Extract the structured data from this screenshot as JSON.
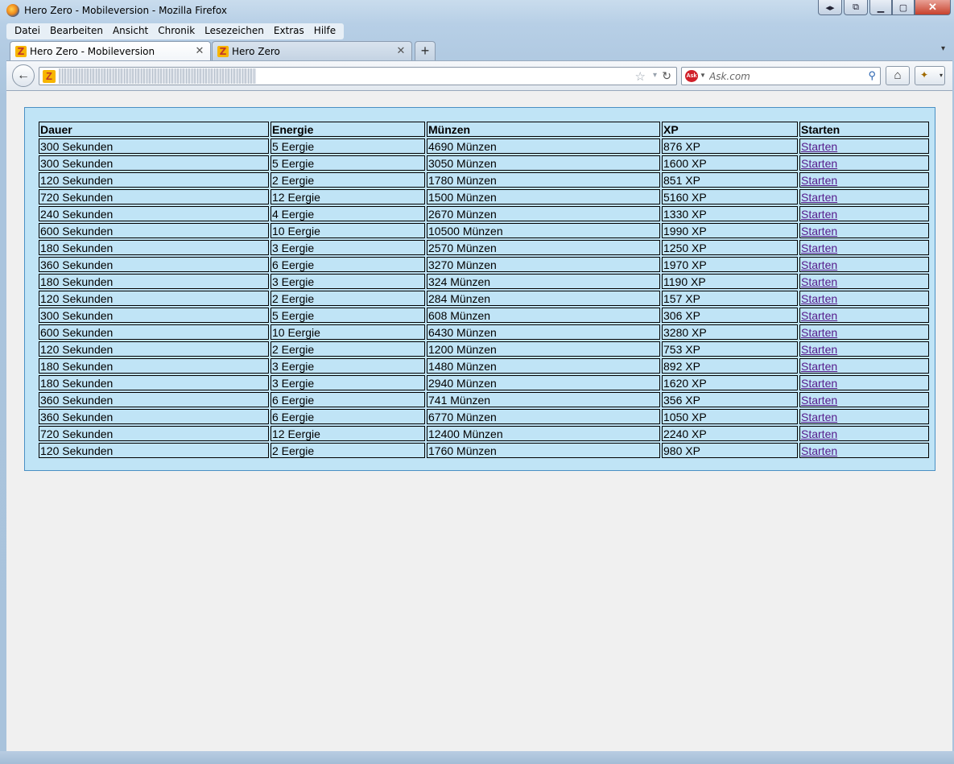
{
  "window": {
    "title": "Hero Zero - Mobileversion - Mozilla Firefox"
  },
  "menubar": {
    "items": [
      "Datei",
      "Bearbeiten",
      "Ansicht",
      "Chronik",
      "Lesezeichen",
      "Extras",
      "Hilfe"
    ]
  },
  "tabs": [
    {
      "label": "Hero Zero - Mobileversion",
      "active": true
    },
    {
      "label": "Hero Zero",
      "active": false
    }
  ],
  "icons": {
    "close": "✕",
    "new_tab": "+",
    "back": "←",
    "home": "⌂",
    "star": "☆",
    "reload": "↻",
    "search": "⚲",
    "dropdown": "▾"
  },
  "search": {
    "placeholder": "Ask.com"
  },
  "table": {
    "headers": [
      "Dauer",
      "Energie",
      "Münzen",
      "XP",
      "Starten"
    ],
    "link_label": "Starten",
    "rows": [
      [
        "300 Sekunden",
        "5 Eergie",
        "4690 Münzen",
        "876 XP"
      ],
      [
        "300 Sekunden",
        "5 Eergie",
        "3050 Münzen",
        "1600 XP"
      ],
      [
        "120 Sekunden",
        "2 Eergie",
        "1780 Münzen",
        "851 XP"
      ],
      [
        "720 Sekunden",
        "12 Eergie",
        "1500 Münzen",
        "5160 XP"
      ],
      [
        "240 Sekunden",
        "4 Eergie",
        "2670 Münzen",
        "1330 XP"
      ],
      [
        "600 Sekunden",
        "10 Eergie",
        "10500 Münzen",
        "1990 XP"
      ],
      [
        "180 Sekunden",
        "3 Eergie",
        "2570 Münzen",
        "1250 XP"
      ],
      [
        "360 Sekunden",
        "6 Eergie",
        "3270 Münzen",
        "1970 XP"
      ],
      [
        "180 Sekunden",
        "3 Eergie",
        "324 Münzen",
        "1190 XP"
      ],
      [
        "120 Sekunden",
        "2 Eergie",
        "284 Münzen",
        "157 XP"
      ],
      [
        "300 Sekunden",
        "5 Eergie",
        "608 Münzen",
        "306 XP"
      ],
      [
        "600 Sekunden",
        "10 Eergie",
        "6430 Münzen",
        "3280 XP"
      ],
      [
        "120 Sekunden",
        "2 Eergie",
        "1200 Münzen",
        "753 XP"
      ],
      [
        "180 Sekunden",
        "3 Eergie",
        "1480 Münzen",
        "892 XP"
      ],
      [
        "180 Sekunden",
        "3 Eergie",
        "2940 Münzen",
        "1620 XP"
      ],
      [
        "360 Sekunden",
        "6 Eergie",
        "741 Münzen",
        "356 XP"
      ],
      [
        "360 Sekunden",
        "6 Eergie",
        "6770 Münzen",
        "1050 XP"
      ],
      [
        "720 Sekunden",
        "12 Eergie",
        "12400 Münzen",
        "2240 XP"
      ],
      [
        "120 Sekunden",
        "2 Eergie",
        "1760 Münzen",
        "980 XP"
      ]
    ]
  },
  "colors": {
    "panel_bg": "#c0e4f6",
    "panel_border": "#4a90c4",
    "link": "#551a8b",
    "page_bg": "#f0f0f0"
  }
}
